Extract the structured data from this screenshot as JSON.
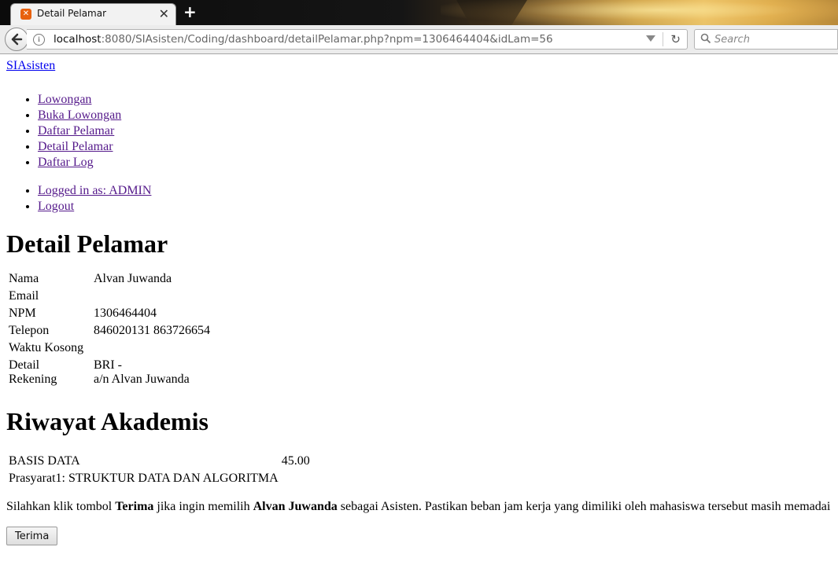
{
  "browser": {
    "tab_title": "Detail Pelamar",
    "tab_favicon": "xampp-icon",
    "new_tab_label": "+",
    "url_host": "localhost",
    "url_rest": ":8080/SIAsisten/Coding/dashboard/detailPelamar.php?npm=1306464404&idLam=56",
    "search_placeholder": "Search"
  },
  "site": {
    "brand": "SIAsisten",
    "nav": [
      "Lowongan",
      "Buka Lowongan",
      "Daftar Pelamar",
      "Detail Pelamar",
      "Daftar Log"
    ],
    "user_menu": [
      "Logged in as: ADMIN",
      "Logout"
    ]
  },
  "detail": {
    "heading": "Detail Pelamar",
    "rows": [
      {
        "label": "Nama",
        "value": "Alvan Juwanda"
      },
      {
        "label": "Email",
        "value": ""
      },
      {
        "label": "NPM",
        "value": "1306464404"
      },
      {
        "label": "Telepon",
        "value": "846020131 863726654"
      },
      {
        "label": "Waktu Kosong",
        "value": ""
      }
    ],
    "rekening_label": "Detail Rekening",
    "rekening_line1": "BRI -",
    "rekening_line2": "a/n Alvan Juwanda"
  },
  "akademis": {
    "heading": "Riwayat Akademis",
    "course": "BASIS DATA",
    "score": "45.00",
    "prereq": "Prasyarat1: STRUKTUR DATA DAN ALGORITMA"
  },
  "note": {
    "part1": "Silahkan klik tombol ",
    "bold1": "Terima",
    "part2": " jika ingin memilih ",
    "bold2": "Alvan Juwanda",
    "part3": " sebagai Asisten. Pastikan beban jam kerja yang dimiliki oleh mahasiswa tersebut masih memadai"
  },
  "button_label": "Terima",
  "colors": {
    "link": "#551a8b",
    "brand_link": "#0000ee",
    "favicon": "#e8610e"
  }
}
